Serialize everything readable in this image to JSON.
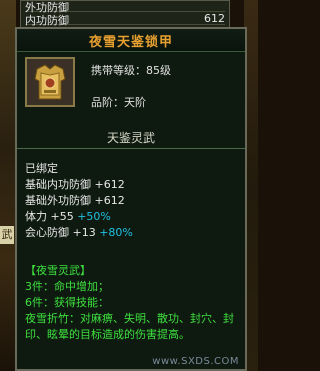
{
  "top_panel": {
    "rows": [
      {
        "label": "外功防御",
        "value": ""
      },
      {
        "label": "内功防御",
        "value": "612"
      }
    ]
  },
  "side": {
    "left_tab": "武"
  },
  "tooltip": {
    "title": "夜雪天鉴锁甲",
    "level_label": "携带等级：",
    "level_value": "85级",
    "rank_label": "品阶：",
    "rank_value": "天阶",
    "item_name": "天鉴灵武",
    "bound": "已绑定",
    "stats": [
      {
        "name": "基础内功防御",
        "value": "+612",
        "pct": ""
      },
      {
        "name": "基础外功防御",
        "value": "+612",
        "pct": ""
      },
      {
        "name": "体力",
        "value": "+55",
        "pct": "+50%"
      },
      {
        "name": "会心防御",
        "value": "+13",
        "pct": "+80%"
      }
    ],
    "set_name": "【夜雪灵武】",
    "set_bonuses": [
      "3件：命中增加；",
      "6件：获得技能："
    ],
    "skill_text": "夜雪折竹：对麻痹、失明、散功、封穴、封印、眩晕的目标造成的伤害提高。",
    "watermark": "www.SXDS.COM"
  }
}
